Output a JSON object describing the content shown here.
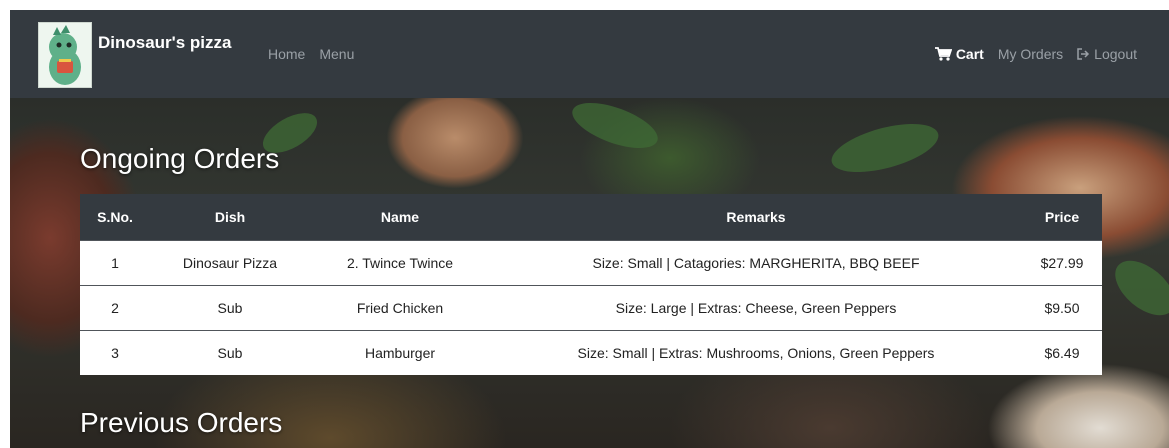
{
  "navbar": {
    "brand": "Dinosaur's pizza",
    "links": [
      "Home",
      "Menu"
    ],
    "cart": "Cart",
    "my_orders": "My Orders",
    "logout": "Logout"
  },
  "ongoing": {
    "title": "Ongoing Orders",
    "headers": [
      "S.No.",
      "Dish",
      "Name",
      "Remarks",
      "Price"
    ],
    "rows": [
      {
        "sno": "1",
        "dish": "Dinosaur Pizza",
        "name": "2. Twince Twince",
        "remarks": "Size: Small | Catagories: MARGHERITA, BBQ BEEF",
        "price": "$27.99"
      },
      {
        "sno": "2",
        "dish": "Sub",
        "name": "Fried Chicken",
        "remarks": "Size: Large | Extras: Cheese, Green Peppers",
        "price": "$9.50"
      },
      {
        "sno": "3",
        "dish": "Sub",
        "name": "Hamburger",
        "remarks": "Size: Small | Extras: Mushrooms, Onions, Green Peppers",
        "price": "$6.49"
      }
    ]
  },
  "previous": {
    "title": "Previous Orders"
  },
  "icons": {
    "cart": "cart-icon",
    "logout": "logout-icon",
    "logo": "dinosaur-logo-icon"
  },
  "colors": {
    "navbar": "#343a40",
    "nav_link": "#9aa0a6",
    "table_header": "#343a40"
  }
}
